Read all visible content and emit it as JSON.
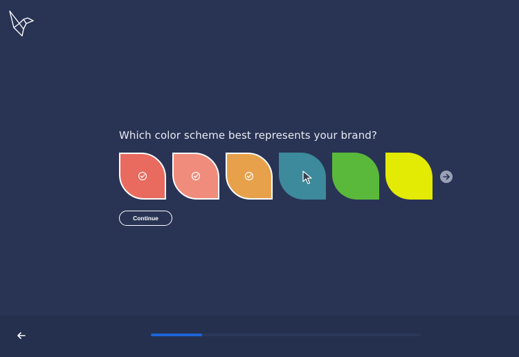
{
  "question": "Which color scheme best represents your brand?",
  "swatches": [
    {
      "name": "coral",
      "color": "#e96a5e",
      "selected": true
    },
    {
      "name": "salmon",
      "color": "#f08c7b",
      "selected": true
    },
    {
      "name": "orange",
      "color": "#e7a14b",
      "selected": true
    },
    {
      "name": "teal",
      "color": "#3c8a9b",
      "selected": false
    },
    {
      "name": "green",
      "color": "#5ab83b",
      "selected": false
    },
    {
      "name": "yellow",
      "color": "#e3ea04",
      "selected": false
    }
  ],
  "continue_label": "Continue",
  "progress": {
    "fraction": 0.19
  },
  "colors": {
    "background": "#293455",
    "footer": "#25304f",
    "accent": "#1c64d8"
  },
  "icons": {
    "logo": "bird-logo-icon",
    "check": "check-circle-icon",
    "next": "arrow-right-icon",
    "back": "arrow-left-icon",
    "cursor": "mouse-pointer-icon"
  }
}
